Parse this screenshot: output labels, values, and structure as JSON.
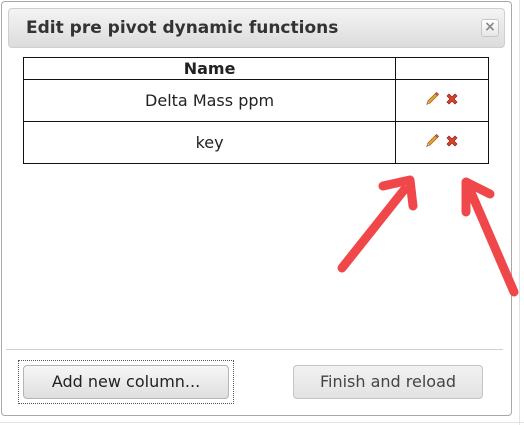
{
  "dialog": {
    "title": "Edit pre pivot dynamic functions",
    "close_glyph": "×"
  },
  "table": {
    "headers": [
      "Name",
      ""
    ],
    "rows": [
      {
        "name": "Delta Mass ppm"
      },
      {
        "name": "key"
      }
    ]
  },
  "buttons": {
    "add_label": "Add new column...",
    "finish_label": "Finish and reload"
  },
  "icons": {
    "edit": "pencil-icon",
    "delete": "red-x-icon"
  },
  "colors": {
    "arrow": "#f0474a",
    "delete": "#d9432f",
    "pencil": "#e8a23a"
  }
}
